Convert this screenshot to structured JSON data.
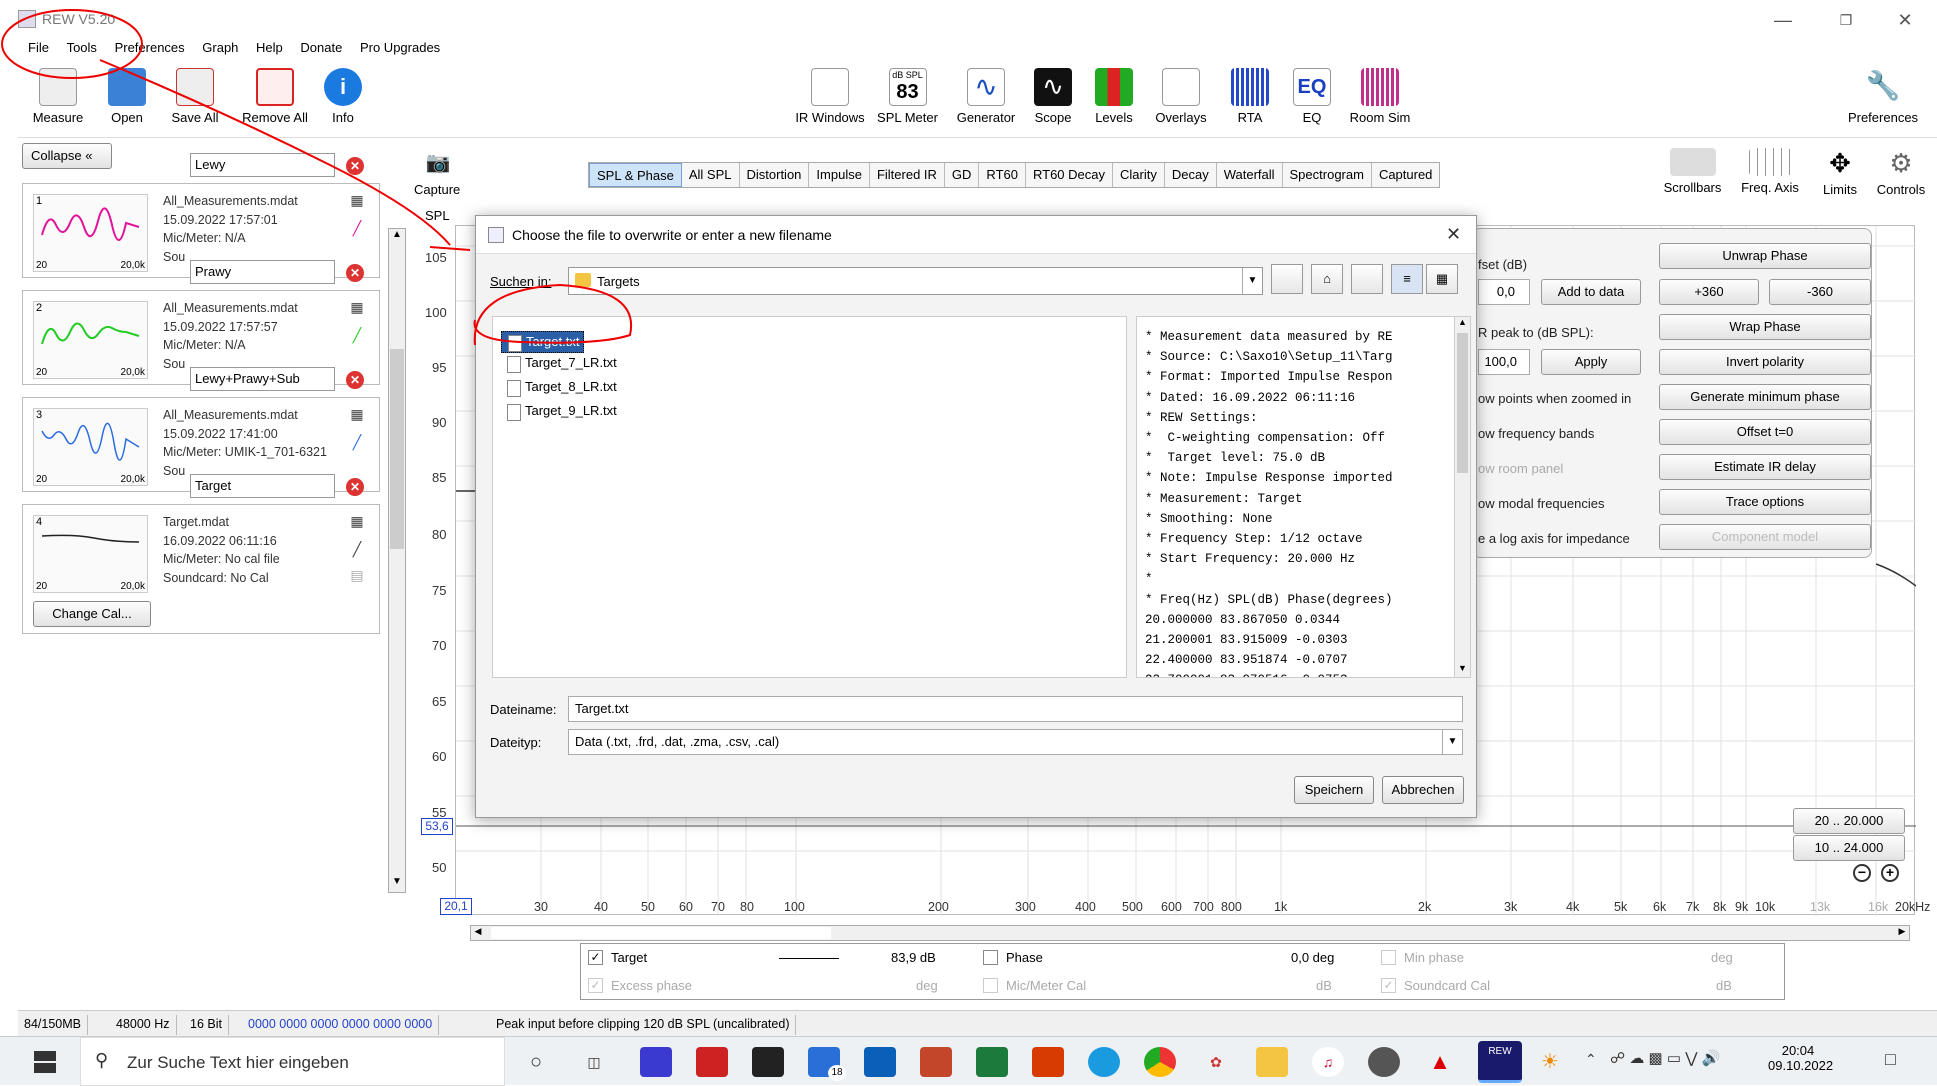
{
  "window": {
    "title": "REW V5.20"
  },
  "menu": [
    "File",
    "Tools",
    "Preferences",
    "Graph",
    "Help",
    "Donate",
    "Pro Upgrades"
  ],
  "toolbar_left": [
    "Measure",
    "Open",
    "Save All",
    "Remove All",
    "Info"
  ],
  "toolbar_center": [
    "IR Windows",
    "SPL Meter",
    "Generator",
    "Scope",
    "Levels",
    "Overlays",
    "RTA",
    "EQ",
    "Room Sim"
  ],
  "spl_meter_icon": {
    "unit": "dB SPL",
    "value": "83"
  },
  "preferences_label": "Preferences",
  "graph_tools": [
    "Scrollbars",
    "Freq. Axis",
    "Limits",
    "Controls"
  ],
  "collapse_label": "Collapse",
  "capture_label": "Capture",
  "spl_label": "SPL",
  "tabs": [
    "SPL & Phase",
    "All SPL",
    "Distortion",
    "Impulse",
    "Filtered IR",
    "GD",
    "RT60",
    "RT60 Decay",
    "Clarity",
    "Decay",
    "Waterfall",
    "Spectrogram",
    "Captured"
  ],
  "measurements": [
    {
      "num": "1",
      "name": "Lewy",
      "file": "All_Measurements.mdat",
      "date": "15.09.2022 17:57:01",
      "mic": "Mic/Meter: N/A",
      "extra": "Sou",
      "color": "#e0139a",
      "lo": "20",
      "hi": "20,0k"
    },
    {
      "num": "2",
      "name": "Prawy",
      "file": "All_Measurements.mdat",
      "date": "15.09.2022 17:57:57",
      "mic": "Mic/Meter: N/A",
      "extra": "Sou",
      "color": "#22cc22",
      "lo": "20",
      "hi": "20,0k"
    },
    {
      "num": "3",
      "name": "Lewy+Prawy+Sub",
      "file": "All_Measurements.mdat",
      "date": "15.09.2022 17:41:00",
      "mic": "Mic/Meter: UMIK-1_701-6321",
      "extra": "Sou",
      "color": "#2a6be0",
      "lo": "20",
      "hi": "20,0k"
    },
    {
      "num": "4",
      "name": "Target",
      "file": "Target.mdat",
      "date": "16.09.2022 06:11:16",
      "mic": "Mic/Meter: No cal file",
      "extra": "Soundcard: No Cal",
      "color": "#222",
      "lo": "20",
      "hi": "20,0k"
    }
  ],
  "change_cal": "Change Cal...",
  "y_axis": [
    "105",
    "100",
    "95",
    "90",
    "85",
    "80",
    "75",
    "70",
    "65",
    "60",
    "55",
    "50"
  ],
  "y_cursor": "53,6",
  "x_cursor": "20,1",
  "x_axis": [
    "30",
    "40",
    "50",
    "60",
    "70",
    "80",
    "100",
    "200",
    "300",
    "400",
    "500",
    "600",
    "700",
    "800",
    "1k",
    "2k",
    "3k",
    "4k",
    "5k",
    "6k",
    "7k",
    "8k",
    "9k",
    "10k",
    "13k",
    "16k",
    "20kHz"
  ],
  "range_buttons": [
    "20 .. 20.000",
    "10 .. 24.000"
  ],
  "controls": {
    "offset_label": "fset (dB)",
    "offset_value": "0,0",
    "add_to_data": "Add to data",
    "ir_peak_label": "R peak to (dB SPL):",
    "ir_peak_value": "100,0",
    "apply": "Apply",
    "lbl_points": "ow points when zoomed in",
    "lbl_bands": "ow frequency bands",
    "lbl_room": "ow room panel",
    "lbl_modal": "ow modal frequencies",
    "lbl_log": "e a log axis for impedance",
    "btns": [
      "Unwrap Phase",
      "+360",
      "-360",
      "Wrap Phase",
      "Invert polarity",
      "Generate minimum phase",
      "Offset t=0",
      "Estimate IR delay",
      "Trace options",
      "Component model"
    ]
  },
  "dialog": {
    "title": "Choose the file to overwrite or enter a new filename",
    "look_in_label": "Suchen in:",
    "look_in_value": "Targets",
    "files": [
      "Target.txt",
      "Target_7_LR.txt",
      "Target_8_LR.txt",
      "Target_9_LR.txt"
    ],
    "preview": "* Measurement data measured by RE\n* Source: C:\\Saxo10\\Setup_11\\Targ\n* Format: Imported Impulse Respon\n* Dated: 16.09.2022 06:11:16\n* REW Settings:\n*  C-weighting compensation: Off\n*  Target level: 75.0 dB\n* Note: Impulse Response imported\n* Measurement: Target\n* Smoothing: None\n* Frequency Step: 1/12 octave\n* Start Frequency: 20.000 Hz\n*\n* Freq(Hz) SPL(dB) Phase(degrees)\n20.000000 83.867050 0.0344\n21.200001 83.915009 -0.0303\n22.400000 83.951874 -0.0707\n23.700001 83.970516 -0.0753",
    "filename_label": "Dateiname:",
    "filename_value": "Target.txt",
    "filetype_label": "Dateityp:",
    "filetype_value": "Data (.txt, .frd, .dat, .zma, .csv, .cal)",
    "save": "Speichern",
    "cancel": "Abbrechen"
  },
  "legend": {
    "target": "Target",
    "target_value": "83,9 dB",
    "phase": "Phase",
    "phase_value": "0,0 deg",
    "min_phase": "Min phase",
    "min_phase_unit": "deg",
    "excess_phase": "Excess phase",
    "excess_unit": "deg",
    "mic_cal": "Mic/Meter Cal",
    "mic_unit": "dB",
    "sc_cal": "Soundcard Cal",
    "sc_unit": "dB"
  },
  "status": [
    "84/150MB",
    "48000 Hz",
    "16 Bit",
    "0000 0000  0000 0000  0000 0000",
    "Peak input before clipping 120 dB SPL (uncalibrated)"
  ],
  "taskbar": {
    "search": "Zur Suche Text hier eingeben",
    "time": "20:04",
    "date": "09.10.2022",
    "badge": "18",
    "rew": "REW"
  }
}
